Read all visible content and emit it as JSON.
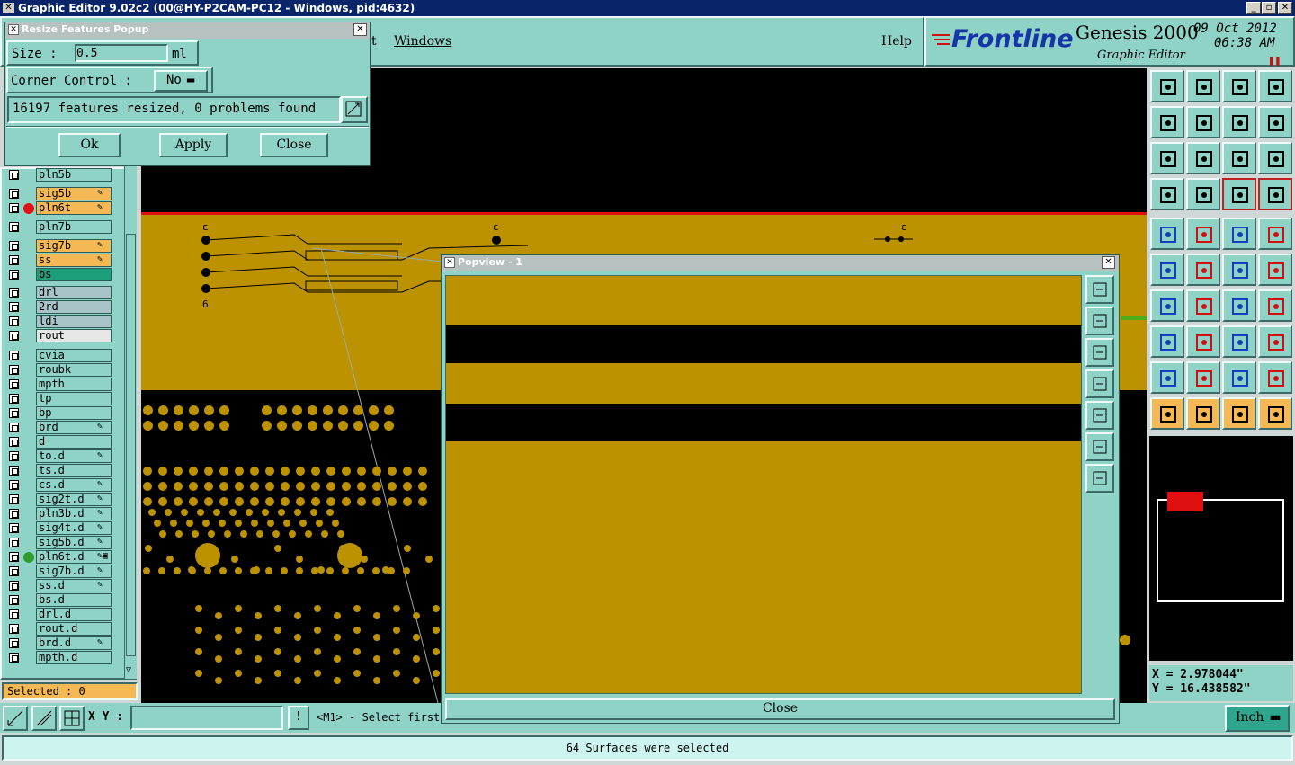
{
  "window": {
    "title": "Graphic Editor 9.02c2 (00@HY-P2CAM-PC12 - Windows, pid:4632)"
  },
  "menu": {
    "partial_item": "t",
    "windows": "Windows",
    "help": "Help"
  },
  "logo": {
    "brand": "Frontline",
    "product": "Genesis 2000",
    "subtitle": "Graphic Editor",
    "date": "09 Oct 2012",
    "time": "06:38 AM"
  },
  "resize_popup": {
    "title": "Resize Features Popup",
    "size_label": "Size :",
    "size_value": "0.5",
    "size_unit": "ml",
    "corner_label": "Corner Control :",
    "corner_value": "No",
    "status": "16197 features resized, 0 problems found",
    "ok": "Ok",
    "apply": "Apply",
    "close": "Close"
  },
  "layers": [
    {
      "name": "pln5b",
      "color": "#8fd2c6",
      "dot": "",
      "mark": ""
    },
    {
      "name": "sig5b",
      "color": "#f4b955",
      "dot": "",
      "mark": "✎"
    },
    {
      "name": "pln6t",
      "color": "#f4b955",
      "dot": "#e01010",
      "mark": "✎"
    },
    {
      "name": "pln7b",
      "color": "#8fd2c6",
      "dot": "",
      "mark": ""
    },
    {
      "name": "sig7b",
      "color": "#f4b955",
      "dot": "",
      "mark": "✎"
    },
    {
      "name": "ss",
      "color": "#f4b955",
      "dot": "",
      "mark": "✎"
    },
    {
      "name": "bs",
      "color": "#1d9e7a",
      "dot": "",
      "mark": ""
    },
    {
      "name": "drl",
      "color": "#a9c4c8",
      "dot": "",
      "mark": ""
    },
    {
      "name": "2rd",
      "color": "#a9c4c8",
      "dot": "",
      "mark": ""
    },
    {
      "name": "ldi",
      "color": "#a9c4c8",
      "dot": "",
      "mark": ""
    },
    {
      "name": "rout",
      "color": "#e6e6e6",
      "dot": "",
      "mark": ""
    },
    {
      "name": "cvia",
      "color": "#8fd2c6",
      "dot": "",
      "mark": ""
    },
    {
      "name": "roubk",
      "color": "#8fd2c6",
      "dot": "",
      "mark": ""
    },
    {
      "name": "mpth",
      "color": "#8fd2c6",
      "dot": "",
      "mark": ""
    },
    {
      "name": "tp",
      "color": "#8fd2c6",
      "dot": "",
      "mark": ""
    },
    {
      "name": "bp",
      "color": "#8fd2c6",
      "dot": "",
      "mark": ""
    },
    {
      "name": "brd",
      "color": "#8fd2c6",
      "dot": "",
      "mark": "✎"
    },
    {
      "name": "d",
      "color": "#8fd2c6",
      "dot": "",
      "mark": ""
    },
    {
      "name": "to.d",
      "color": "#8fd2c6",
      "dot": "",
      "mark": "✎"
    },
    {
      "name": "ts.d",
      "color": "#8fd2c6",
      "dot": "",
      "mark": ""
    },
    {
      "name": "cs.d",
      "color": "#8fd2c6",
      "dot": "",
      "mark": "✎"
    },
    {
      "name": "sig2t.d",
      "color": "#8fd2c6",
      "dot": "",
      "mark": "✎"
    },
    {
      "name": "pln3b.d",
      "color": "#8fd2c6",
      "dot": "",
      "mark": "✎"
    },
    {
      "name": "sig4t.d",
      "color": "#8fd2c6",
      "dot": "",
      "mark": "✎"
    },
    {
      "name": "sig5b.d",
      "color": "#8fd2c6",
      "dot": "",
      "mark": "✎"
    },
    {
      "name": "pln6t.d",
      "color": "#8fd2c6",
      "dot": "#2e9a2e",
      "mark": "✎▣"
    },
    {
      "name": "sig7b.d",
      "color": "#8fd2c6",
      "dot": "",
      "mark": "✎"
    },
    {
      "name": "ss.d",
      "color": "#8fd2c6",
      "dot": "",
      "mark": "✎"
    },
    {
      "name": "bs.d",
      "color": "#8fd2c6",
      "dot": "",
      "mark": ""
    },
    {
      "name": "drl.d",
      "color": "#8fd2c6",
      "dot": "",
      "mark": ""
    },
    {
      "name": "rout.d",
      "color": "#8fd2c6",
      "dot": "",
      "mark": ""
    },
    {
      "name": "brd.d",
      "color": "#8fd2c6",
      "dot": "",
      "mark": "✎"
    },
    {
      "name": "mpth.d",
      "color": "#8fd2c6",
      "dot": "",
      "mark": ""
    }
  ],
  "selected": "Selected : 0",
  "popview": {
    "title": "Popview - 1",
    "close": "Close"
  },
  "coords": {
    "x": "X = 2.978044\"",
    "y": "Y = 16.438582\""
  },
  "bottom": {
    "xy_label": "X Y :",
    "xy_value": "",
    "prompt": "<M1> - Select first",
    "unit": "Inch",
    "status": "64 Surfaces were selected"
  },
  "colors": {
    "board": "#bc9200",
    "panel": "#8fd2c6",
    "highlight": "#f4b955",
    "title": "#0a246a",
    "red_line": "#e01010"
  }
}
